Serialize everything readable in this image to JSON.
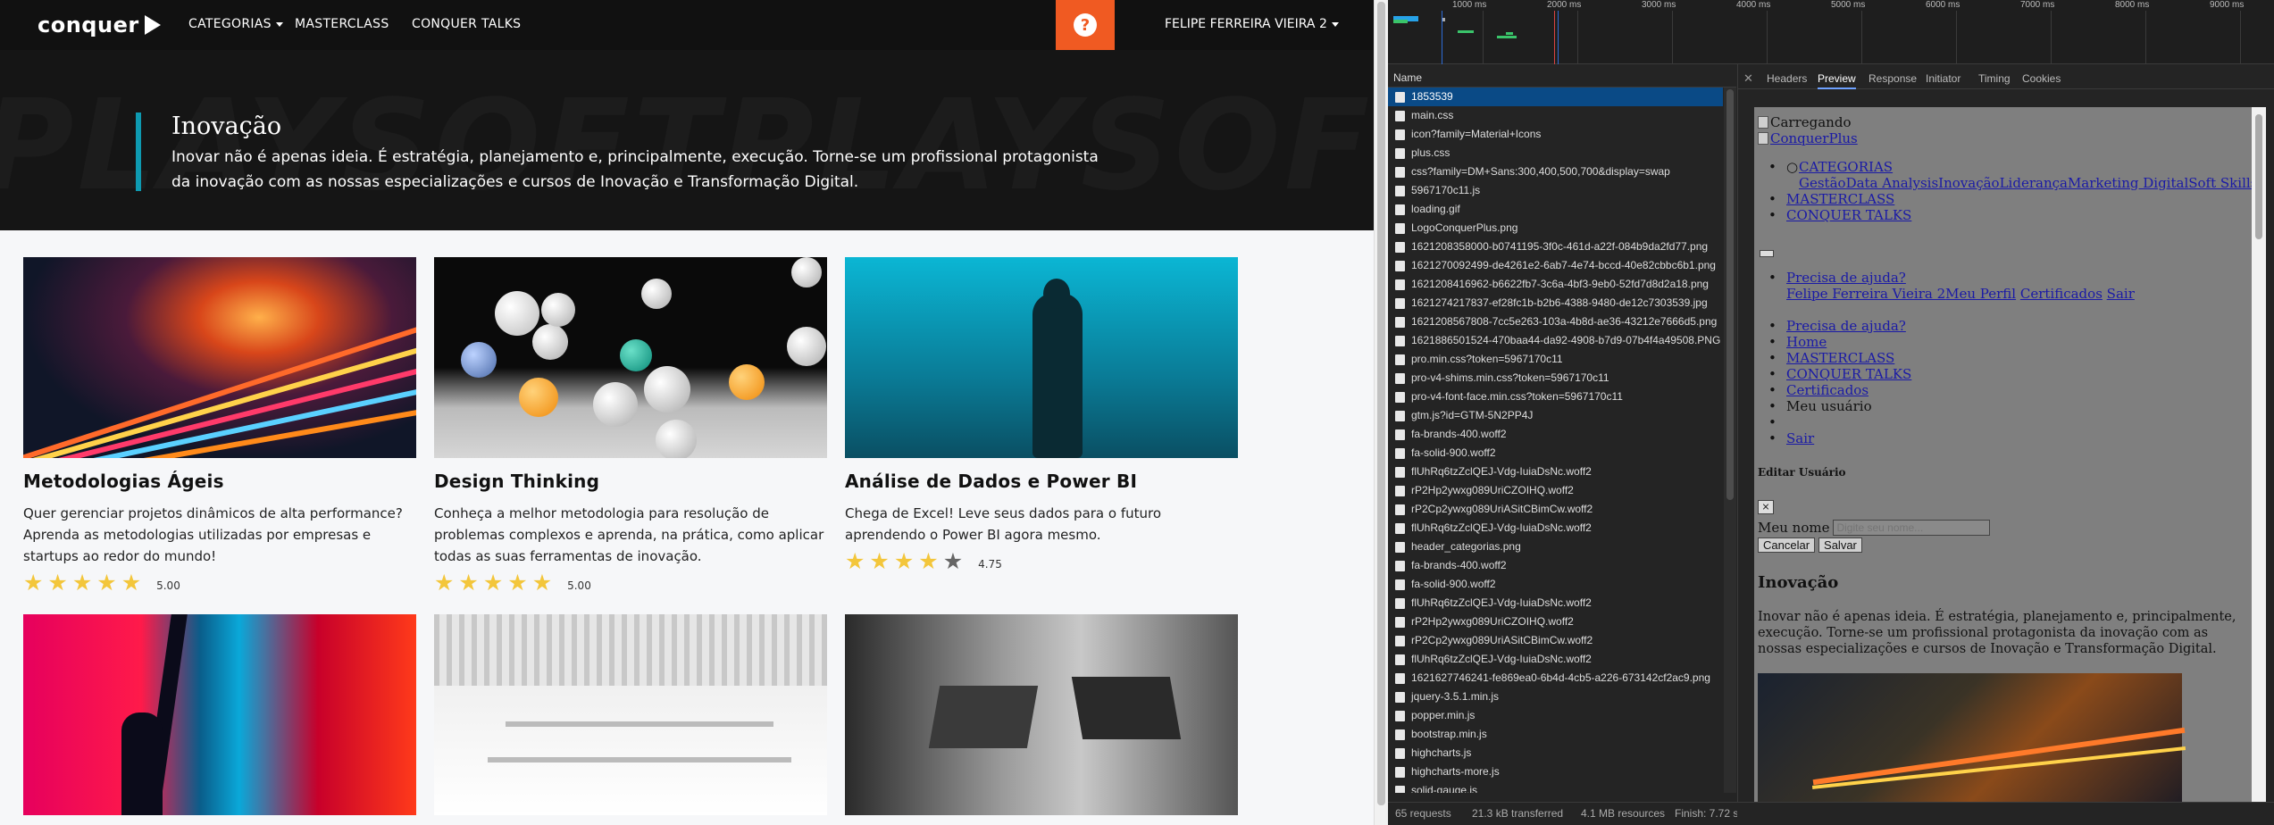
{
  "nav": {
    "logo": "conquer",
    "links": [
      "CATEGORIAS",
      "MASTERCLASS",
      "CONQUER TALKS"
    ],
    "help_icon": "question-icon",
    "user": "FELIPE FERREIRA VIEIRA 2"
  },
  "hero": {
    "bg_text": "PLAYSOFTPLAYSOFT",
    "title": "Inovação",
    "description": "Inovar não é apenas ideia. É estratégia, planejamento e, principalmente, execução. Torne-se um profissional protagonista da inovação com as nossas especializações e cursos de Inovação e Transformação Digital."
  },
  "cards": [
    {
      "title": "Metodologias Ágeis",
      "description": "Quer gerenciar projetos dinâmicos de alta performance? Aprenda as metodologias utilizadas por empresas e startups ao redor do mundo!",
      "rating": "5.00",
      "stars": 5
    },
    {
      "title": "Design Thinking",
      "description": "Conheça a melhor metodologia para resolução de problemas complexos e aprenda, na prática, como aplicar todas as suas ferramentas de inovação.",
      "rating": "5.00",
      "stars": 5
    },
    {
      "title": "Análise de Dados e Power BI",
      "description": "Chega de Excel! Leve seus dados para o futuro aprendendo o Power BI agora mesmo.",
      "rating": "4.75",
      "stars": 4.75
    }
  ],
  "devtools": {
    "timeline_ticks": [
      "1000 ms",
      "2000 ms",
      "3000 ms",
      "4000 ms",
      "5000 ms",
      "6000 ms",
      "7000 ms",
      "8000 ms",
      "9000 ms"
    ],
    "column_name": "Name",
    "requests": [
      "1853539",
      "main.css",
      "icon?family=Material+Icons",
      "plus.css",
      "css?family=DM+Sans:300,400,500,700&display=swap",
      "5967170c11.js",
      "loading.gif",
      "LogoConquerPlus.png",
      "1621208358000-b0741195-3f0c-461d-a22f-084b9da2fd77.png",
      "1621270092499-de4261e2-6ab7-4e74-bccd-40e82cbbc6b1.png",
      "1621208416962-b6622fb7-3c6a-4bf3-9eb0-52fd7d8d2a18.png",
      "1621274217837-ef28fc1b-b2b6-4388-9480-de12c7303539.jpg",
      "1621208567808-7cc5e263-103a-4b8d-ae36-43212e7666d5.png",
      "1621886501524-470baa44-da92-4908-b7d9-07b4f4a49508.PNG",
      "pro.min.css?token=5967170c11",
      "pro-v4-shims.min.css?token=5967170c11",
      "pro-v4-font-face.min.css?token=5967170c11",
      "gtm.js?id=GTM-5N2PP4J",
      "fa-brands-400.woff2",
      "fa-solid-900.woff2",
      "flUhRq6tzZclQEJ-Vdg-IuiaDsNc.woff2",
      "rP2Hp2ywxg089UriCZOIHQ.woff2",
      "rP2Cp2ywxg089UriASitCBimCw.woff2",
      "flUhRq6tzZclQEJ-Vdg-IuiaDsNc.woff2",
      "header_categorias.png",
      "fa-brands-400.woff2",
      "fa-solid-900.woff2",
      "flUhRq6tzZclQEJ-Vdg-IuiaDsNc.woff2",
      "rP2Hp2ywxg089UriCZOIHQ.woff2",
      "rP2Cp2ywxg089UriASitCBimCw.woff2",
      "flUhRq6tzZclQEJ-Vdg-IuiaDsNc.woff2",
      "1621627746241-fe869ea0-6b4d-4cb5-a226-673142cf2ac9.png",
      "jquery-3.5.1.min.js",
      "popper.min.js",
      "bootstrap.min.js",
      "highcharts.js",
      "highcharts-more.js",
      "solid-gauge.js"
    ],
    "tabs": [
      "Headers",
      "Preview",
      "Response",
      "Initiator",
      "Timing",
      "Cookies"
    ],
    "active_tab": "Preview",
    "preview": {
      "carregando": "Carregando",
      "conquerplus": "ConquerPlus",
      "categorias": "CATEGORIAS",
      "subcats": [
        "Gestão",
        "Data Analysis",
        "Inovação",
        "Liderança",
        "Marketing Digital",
        "Soft Skills"
      ],
      "masterclass": "MASTERCLASS",
      "conquer_talks": "CONQUER TALKS",
      "precisa": "Precisa de ajuda?",
      "user_links": [
        "Felipe Ferreira Vieira 2",
        "Meu Perfil",
        "Certificados",
        "Sair"
      ],
      "menu": [
        "Precisa de ajuda?",
        "Home",
        "MASTERCLASS",
        "CONQUER TALKS",
        "Certificados"
      ],
      "meu_usuario": "Meu usuário",
      "sair": "Sair",
      "editar": "Editar Usuário",
      "close": "×",
      "meu_nome_label": "Meu nome",
      "meu_nome_placeholder": "Digite seu nome...",
      "cancelar": "Cancelar",
      "salvar": "Salvar",
      "inovacao": "Inovação",
      "inovacao_text": "Inovar não é apenas ideia. É estratégia, planejamento e, principalmente, execução. Torne-se um profissional protagonista da inovação com as nossas especializações e cursos de Inovação e Transformação Digital."
    },
    "status": {
      "requests": "65 requests",
      "transferred": "21.3 kB transferred",
      "resources": "4.1 MB resources",
      "finish": "Finish: 7.72 s"
    }
  }
}
